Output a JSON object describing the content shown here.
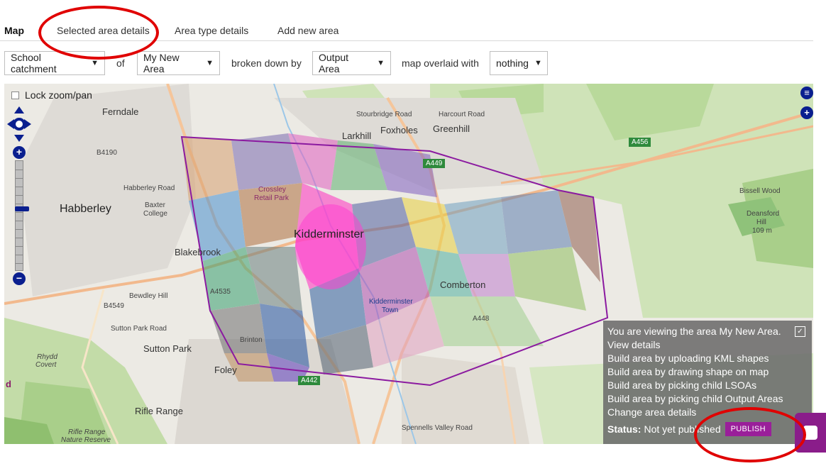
{
  "tabs": [
    {
      "label": "Map",
      "active": true
    },
    {
      "label": "Selected area details",
      "active": false
    },
    {
      "label": "Area type details",
      "active": false
    },
    {
      "label": "Add new area",
      "active": false
    }
  ],
  "controls": {
    "area_type": "School catchment",
    "of_label": "of",
    "area": "My New Area",
    "broken_label": "broken down by",
    "breakdown": "Output Area",
    "overlay_label": "map overlaid with",
    "overlay": "nothing"
  },
  "map": {
    "lock_label": "Lock zoom/pan",
    "labels": {
      "ferndale": "Ferndale",
      "larkhill": "Larkhill",
      "foxholes": "Foxholes",
      "greenhill": "Greenhill",
      "habberley": "Habberley",
      "habberley_road": "Habberley Road",
      "baxter": "Baxter",
      "college": "College",
      "crossley1": "Crossley",
      "crossley2": "Retail Park",
      "kidderminster": "Kidderminster",
      "blakebrook": "Blakebrook",
      "bewdley_hill": "Bewdley Hill",
      "b4549": "B4549",
      "b4190": "B4190",
      "a449": "A449",
      "a456": "A456",
      "a442": "A442",
      "a448": "A448",
      "a4535": "A4535",
      "stourbridge_road": "Stourbridge Road",
      "harcourt_road": "Harcourt Road",
      "bissell_wood": "Bissell Wood",
      "deansford1": "Deansford",
      "deansford2": "Hill",
      "deansford3": "109 m",
      "comberton": "Comberton",
      "kidd_town1": "Kidderminster",
      "kidd_town2": "Town",
      "sutton_park": "Sutton Park",
      "brinton": "Brinton",
      "foley": "Foley",
      "rifle_range": "Rifle Range",
      "rifle_range_nr1": "Rifle Range",
      "rifle_range_nr2": "Nature Reserve",
      "rhydd1": "Rhydd",
      "rhydd2": "Covert",
      "offedge_d": "d",
      "spennells_valley_road": "Spennells Valley Road",
      "sutton_park_road": "Sutton Park Road"
    }
  },
  "info_panel": {
    "viewing": "You are viewing the area My New Area.",
    "close_icon": "✓",
    "links": [
      "View details",
      "Build area by uploading KML shapes",
      "Build area by drawing shape on map",
      "Build area by picking child LSOAs",
      "Build area by picking child Output Areas",
      "Change area details"
    ],
    "status_label": "Status:",
    "status_value": "Not yet published",
    "publish_label": "PUBLISH"
  },
  "colors": {
    "accent_purple": "#9a1f9a",
    "annotation_red": "#e00000",
    "map_control_blue": "#0a1f8f"
  }
}
